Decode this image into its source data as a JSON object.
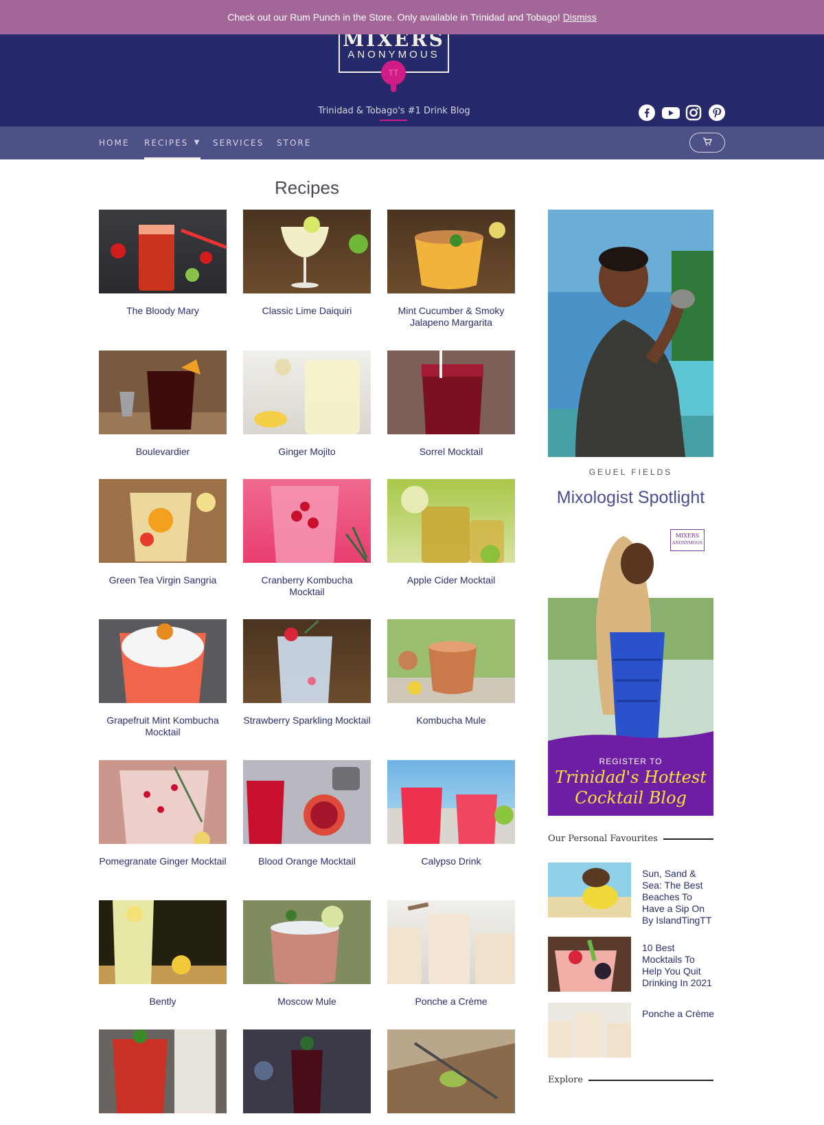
{
  "notice": {
    "text": "Check out our Rum Punch in the Store. Only available in Trinidad and Tobago!",
    "dismiss": "Dismiss"
  },
  "brand": {
    "line1": "MIXERS",
    "line2": "ANONYMOUS",
    "mark": "TT",
    "tagline": "Trinidad & Tobago's #1 Drink Blog"
  },
  "colors": {
    "header": "#272a6a",
    "nav": "#4d5188",
    "notice": "#a26798",
    "accent": "#cf1c86"
  },
  "socials": [
    "facebook-icon",
    "youtube-icon",
    "instagram-icon",
    "pinterest-icon"
  ],
  "nav": {
    "items": [
      "HOME",
      "RECIPES",
      "SERVICES",
      "STORE"
    ],
    "active": "RECIPES",
    "cart_icon": "cart-icon"
  },
  "page": {
    "title": "Recipes"
  },
  "recipes": [
    "The Bloody Mary",
    "Classic Lime Daiquiri",
    "Mint Cucumber & Smoky Jalapeno Margarita",
    "Boulevardier",
    "Ginger Mojito",
    "Sorrel Mocktail",
    "Green Tea Virgin Sangria",
    "Cranberry Kombucha Mocktail",
    "Apple Cider Mocktail",
    "Grapefruit Mint Kombucha Mocktail",
    "Strawberry Sparkling Mocktail",
    "Kombucha Mule",
    "Pomegranate Ginger Mocktail",
    "Blood Orange Mocktail",
    "Calypso Drink",
    "Bently",
    "Moscow Mule",
    "Ponche a Crème",
    "",
    "",
    ""
  ],
  "sidebar": {
    "photo_caption": "GEUEL FIELDS",
    "spotlight_title": "Mixologist Spotlight",
    "banner": {
      "line1": "REGISTER TO",
      "line2": "Trinidad's Hottest",
      "line3": "Cocktail Blog",
      "logo_line1": "MIXERS",
      "logo_line2": "ANONYMOUS"
    },
    "favourites_heading": "Our Personal Favourites",
    "favourites": [
      "Sun, Sand & Sea: The Best Beaches To Have a Sip On By IslandTingTT",
      "10 Best Mocktails To Help You Quit Drinking In 2021",
      "Ponche a Crème"
    ],
    "explore_heading": "Explore"
  }
}
